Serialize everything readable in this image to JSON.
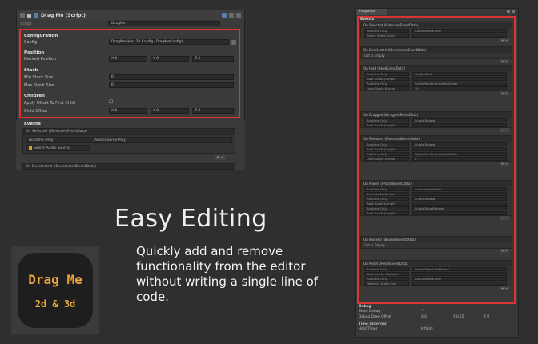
{
  "left_inspector": {
    "component_title": "Drag Me (Script)",
    "script_label": "Script",
    "script_value": "DragMe",
    "sections": {
      "configuration": "Configuration",
      "config_label": "Config",
      "config_value": "DragMe Hold 2d Config (DragMeConfig)",
      "position": "Position",
      "desired_position_label": "Desired Position",
      "pos_x": "X 0",
      "pos_y": "Y 0",
      "pos_z": "Z 0",
      "stack": "Stack",
      "min_stack_label": "Min Stack Size",
      "min_stack_value": "0",
      "max_stack_label": "Max Stack Size",
      "max_stack_value": "0",
      "children": "Children",
      "apply_offset_label": "Apply Offset To First Child",
      "apply_offset_value": "☐",
      "child_offset_label": "Child Offset",
      "child_x": "X 0",
      "child_y": "Y 0",
      "child_z": "Z 0"
    },
    "events": {
      "title": "Events",
      "on_selected": "On Selected (ISelectedEventData)",
      "runtime_only": "Runtime Only",
      "audio_play": "AudioSource.Play",
      "select_audio": "Select Audio Source",
      "on_deselected": "On Deselected (IDeselectedEventData)"
    }
  },
  "headline": "Easy Editing",
  "description": "Quickly add and remove functionality from the editor without writing a single line of code.",
  "logo": {
    "line1": "Drag Me",
    "line2": "2d & 3d"
  },
  "right_inspector": {
    "tab": "Inspector",
    "events_title": "Events",
    "blocks": [
      {
        "header": "On Selected (ISelectedEventData)",
        "lines": [
          [
            "Runtime Only",
            "AudioSource.Play"
          ],
          [
            "Select Audio Sourc",
            ""
          ]
        ]
      },
      {
        "header": "On Deselected (IDeselectedEventData)",
        "empty": "List is Empty"
      },
      {
        "header": "On Hold (IHoldEventData)",
        "lines": [
          [
            "Runtime Only",
            "Single.Scale"
          ],
          [
            "Boot Scroll (Length",
            ""
          ],
          [
            "Runtime Only",
            "SpriteRenderer.sortingOrder"
          ],
          [
            "Liver Dayle Anchor",
            "30"
          ]
        ]
      },
      {
        "header": "On Dragged (IDraggedEventData)",
        "lines": [
          [
            "Runtime Only",
            "Single.Rotate"
          ],
          [
            "Boot Scroll (Length",
            ""
          ]
        ]
      },
      {
        "header": "On Released (IReleasedEventData)",
        "lines": [
          [
            "Runtime Only",
            "Single.Rotate"
          ],
          [
            "Boot Scroll (Length",
            ""
          ],
          [
            "Runtime Only",
            "SpriteRenderer.sortingOrder"
          ],
          [
            "Liver Dayle Anchor",
            "0"
          ]
        ]
      },
      {
        "header": "On Placed (IPlacedEventData)",
        "lines": [
          [
            "Runtime Only",
            "AudioSource.Play"
          ],
          [
            "Success Audio Sou",
            ""
          ],
          [
            "Runtime Only",
            "Single.Rotate"
          ],
          [
            "Boot Scroll (Length",
            ""
          ],
          [
            "Runtime Only",
            "Single.ResetRotate"
          ],
          [
            "Boot Scroll (Length",
            ""
          ]
        ]
      },
      {
        "header": "On Blocked (IBlockedEventData)",
        "empty": "List is Empty"
      },
      {
        "header": "On Reset (IResetEventData)",
        "lines": [
          [
            "Runtime Only",
            "GameObject.SetActive"
          ],
          [
            "Deselection Manager",
            ""
          ],
          [
            "Runtime Only",
            "AudioSource.Play"
          ],
          [
            "Deselect Audio Sou",
            ""
          ]
        ]
      }
    ],
    "debug": {
      "title": "Debug",
      "show_debug": "Show Debug",
      "show_debug_value": "✓",
      "debug_draw_offset": "Debug Draw Offset",
      "dx": "X 0",
      "dy": "Y 0.25",
      "dz": "Z 0",
      "time_internal": "Time (Internal)",
      "hold_timer": "Hold Timer",
      "hold_value": "Infinity"
    }
  }
}
